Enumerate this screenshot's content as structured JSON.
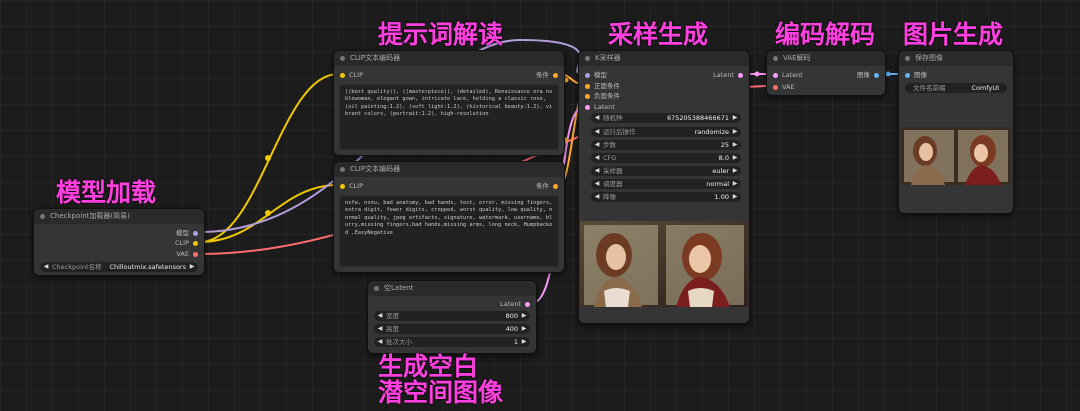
{
  "annotations": {
    "prompt": "提示词解读",
    "sampling": "采样生成",
    "codec": "编码解码",
    "image_gen": "图片生成",
    "model_load": "模型加载",
    "empty_latent_1": "生成空白",
    "empty_latent_2": "潜空间图像"
  },
  "checkpoint_node": {
    "title": "Checkpoint加载器(简易)",
    "out_model": "模型",
    "out_clip": "CLIP",
    "out_vae": "VAE",
    "ckpt_label": "Checkpoint名称",
    "ckpt_value": "Chilloutmix.safetensors"
  },
  "clip_pos_node": {
    "title": "CLIP文本编码器",
    "in_clip": "CLIP",
    "out_cond": "条件",
    "text": "((best quality)), ((masterpiece)), (detailed), Renaissance era noblewoman, elegant gown, intricate lace, holding a classic rose, (oil painting:1.2), (soft light:1.2), (historical beauty:1.2), vibrant colors, (portrait:1.2), high-resolution"
  },
  "clip_neg_node": {
    "title": "CLIP文本编码器",
    "in_clip": "CLIP",
    "out_cond": "条件",
    "text": "nsfw, nsnu, bad anatomy, bad hands, text, error, missing fingers, extra digit, fewer digits, cropped, worst quality, low quality, normal quality, jpeg artifacts, signature, watermark, username, blurry,missing fingers,bad hands,missing arms, long neck, Humpbacked ,EasyNegative"
  },
  "latent_node": {
    "title": "空Latent",
    "out_latent": "Latent",
    "w_label": "宽度",
    "w_value": "800",
    "h_label": "高度",
    "h_value": "400",
    "b_label": "批次大小",
    "b_value": "1"
  },
  "ksampler_node": {
    "title": "K采样器",
    "in_model": "模型",
    "in_pos": "正面条件",
    "in_neg": "负面条件",
    "in_latent": "Latent",
    "out_latent": "Latent",
    "widgets": [
      {
        "label": "随机种",
        "value": "675205388466671"
      },
      {
        "label": "运行后操作",
        "value": "randomize"
      },
      {
        "label": "步数",
        "value": "25"
      },
      {
        "label": "CFG",
        "value": "8.0"
      },
      {
        "label": "采样器",
        "value": "euler"
      },
      {
        "label": "调度器",
        "value": "normal"
      },
      {
        "label": "降噪",
        "value": "1.00"
      }
    ]
  },
  "vae_node": {
    "title": "VAE解码",
    "in_latent": "Latent",
    "in_vae": "VAE",
    "out_image": "图像"
  },
  "save_node": {
    "title": "保存图像",
    "in_image": "图像",
    "prefix_label": "文件名前缀",
    "prefix_value": "ComfyUI"
  },
  "colors": {
    "accent_annotation": "#ff3fe0",
    "wire_clip": "#f0c800",
    "wire_vae": "#ff6e6e",
    "wire_latent": "#ff9cf9",
    "wire_model": "#b39ddb",
    "wire_cond": "#ffa931",
    "wire_image": "#64b5f6"
  }
}
